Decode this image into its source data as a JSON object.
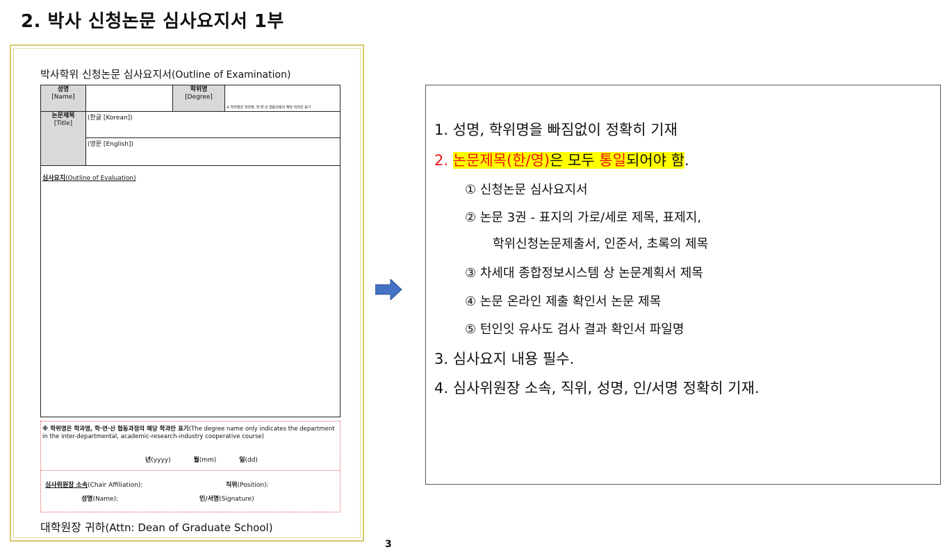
{
  "heading": "2. 박사 신청논문 심사요지서 1부",
  "form": {
    "title_ko": "박사학위 신청논문 심사요지서",
    "title_en": "(Outline of Examination)",
    "name_ko": "성명",
    "name_en": "[Name]",
    "degree_ko": "학위명",
    "degree_en": "[Degree]",
    "degree_note": "※ 학위명은 학과명, 학·연·산 협동과정의 해당 학과만 표기",
    "thesis_ko": "논문제목",
    "thesis_en": "[Title]",
    "korean_label": "(한글 [Korean])",
    "english_label": "(영문 [English])",
    "outline_ko": "심사요지",
    "outline_en": "(Outline of Evaluation)",
    "note_ko": "※ 학위명은 학과명, 학·연·산 협동과정의 해당 학과만 표기",
    "note_en": "(The degree name only indicates the department in the inter-departmental, academic-research-industry cooperative course)",
    "year": "년",
    "year_en": "(yyyy)",
    "month": "월",
    "month_en": "(mm)",
    "day": "일",
    "day_en": "(dd)",
    "chair_ko": "심사위원장 소속",
    "chair_en": "(Chair Affiliation):",
    "position_ko": "직위",
    "position_en": "(Position):",
    "sig_name_ko": "성명",
    "sig_name_en": "(Name):",
    "signature_ko": "인/서명",
    "signature_en": "(Signature)",
    "footer_ko": "대학원장 귀하",
    "footer_en": "(Attn: Dean of Graduate School)"
  },
  "info": {
    "item1": "1.   성명, 학위명을 빠짐없이 정확히 기재",
    "item2_num": "2.   ",
    "item2_a": "논문제목(한/영)",
    "item2_b": "은 모두 ",
    "item2_c": "통일",
    "item2_d": "되어야 함",
    "item2_e": ".",
    "sub1": "① 신청논문 심사요지서",
    "sub2a": "② 논문 3권 - 표지의 가로/세로 제목, 표제지,",
    "sub2b": "학위신청논문제출서, 인준서, 초록의 제목",
    "sub3": "③  차세대 종합정보시스템 상 논문계획서 제목",
    "sub4": "④  논문 온라인 제출 확인서 논문 제목",
    "sub5": "⑤  턴인잇 유사도 검사 결과 확인서 파일명",
    "item3": "3.     심사요지 내용 필수.",
    "item4": "4.     심사위원장 소속, 직위, 성명, 인/서명 정확히 기재."
  },
  "page_number": "3",
  "colors": {
    "highlight": "#ffff00",
    "emphasis": "#ee1111",
    "arrow": "#4472c4"
  }
}
